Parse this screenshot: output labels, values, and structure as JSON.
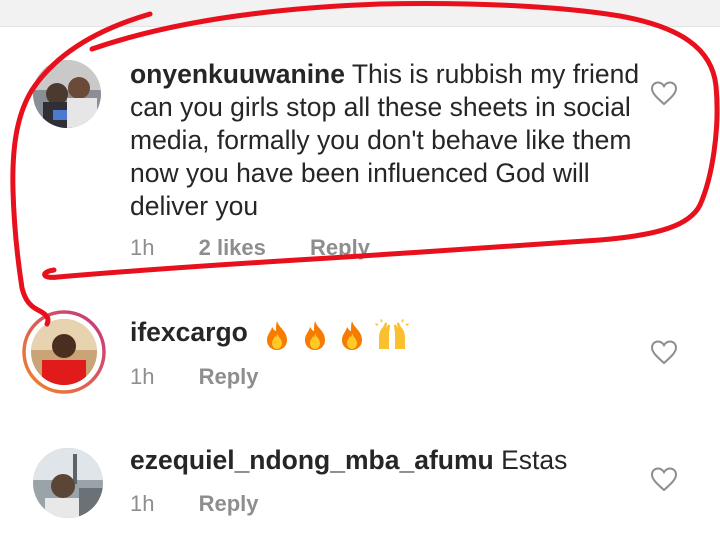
{
  "comments": [
    {
      "username": "onyenkuuwanine",
      "text": "This is rubbish my friend can you girls stop all these sheets in social media, formally you don't behave like them now you have been influenced God will deliver you",
      "time": "1h",
      "likes": "2 likes",
      "reply_label": "Reply",
      "avatar_icon": "user-photo-avatar",
      "like_icon": "heart-outline-icon"
    },
    {
      "username": "ifexcargo",
      "text": "",
      "emojis": [
        "fire-emoji",
        "fire-emoji",
        "fire-emoji",
        "raised-hands-emoji"
      ],
      "time": "1h",
      "reply_label": "Reply",
      "avatar_icon": "user-photo-avatar-story-ring",
      "like_icon": "heart-outline-icon"
    },
    {
      "username": "ezequiel_ndong_mba_afumu",
      "text": "Estas",
      "time": "1h",
      "reply_label": "Reply",
      "avatar_icon": "user-photo-avatar",
      "like_icon": "heart-outline-icon"
    }
  ],
  "colors": {
    "text": "#262626",
    "meta": "#8e8e8e",
    "heart_outline": "#8e8e8e",
    "annotation": "#e8101c",
    "story_ring_start": "#f58529",
    "story_ring_end": "#c13584"
  }
}
